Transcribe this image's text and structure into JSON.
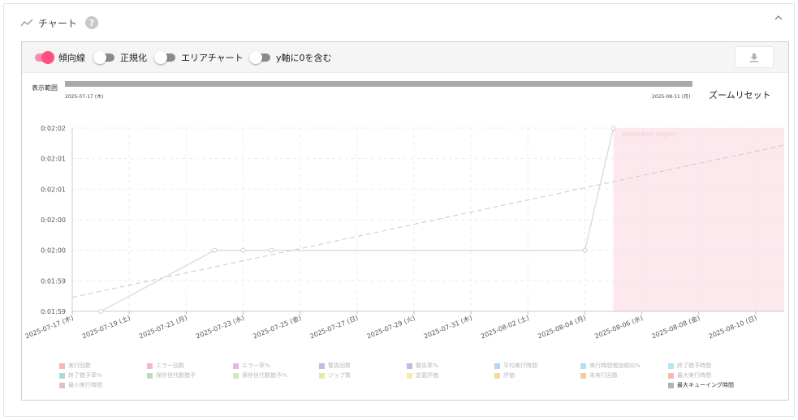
{
  "header": {
    "title": "チャート",
    "help_label": "?"
  },
  "toolbar": {
    "toggles": [
      {
        "label": "傾向線",
        "on": true
      },
      {
        "label": "正規化",
        "on": false
      },
      {
        "label": "エリアチャート",
        "on": false
      },
      {
        "label": "y軸に0を含む",
        "on": false
      }
    ]
  },
  "range": {
    "label": "表示範囲",
    "start": "2025-07-17 (木)",
    "end": "2025-08-11 (月)",
    "zoom_reset": "ズームリセット"
  },
  "colors": {
    "accent": "#ff4f81",
    "prediction_fill": "#fde8ee",
    "line": "#d9d9d9",
    "trend": "#d6c4c8"
  },
  "chart_data": {
    "type": "line",
    "title": "",
    "xlabel": "",
    "ylabel": "",
    "x_ticks": [
      "2025-07-17 (木)",
      "2025-07-19 (土)",
      "2025-07-21 (月)",
      "2025-07-23 (水)",
      "2025-07-25 (金)",
      "2025-07-27 (日)",
      "2025-07-29 (火)",
      "2025-07-31 (木)",
      "2025-08-02 (土)",
      "2025-08-04 (月)",
      "2025-08-06 (水)",
      "2025-08-08 (金)",
      "2025-08-10 (日)"
    ],
    "y_ticks": [
      "0:01:59",
      "0:01:59",
      "0:02:00",
      "0:02:00",
      "0:02:01",
      "0:02:01",
      "0:02:02"
    ],
    "y_tick_values": [
      119.0,
      119.5,
      120.0,
      120.5,
      121.0,
      121.5,
      122.0
    ],
    "ylim": [
      119.0,
      122.0
    ],
    "xlim": [
      "2025-07-17",
      "2025-08-11"
    ],
    "grid": true,
    "series": [
      {
        "name": "最大キューイング時間",
        "x": [
          "2025-07-18",
          "2025-07-22",
          "2025-07-23",
          "2025-07-24",
          "2025-08-04",
          "2025-08-05"
        ],
        "values": [
          119.0,
          120.0,
          120.0,
          120.0,
          120.0,
          122.0
        ]
      }
    ],
    "trend_line": {
      "x": [
        "2025-07-17",
        "2025-08-11"
      ],
      "values": [
        119.23,
        121.72
      ]
    },
    "prediction_region": {
      "label": "prediction region",
      "x_start": "2025-08-05",
      "x_end": "2025-08-11"
    },
    "legend": [
      {
        "label": "実行回数",
        "color": "#f4b8b8",
        "active": false
      },
      {
        "label": "エラー回数",
        "color": "#f7b6c8",
        "active": false
      },
      {
        "label": "エラー率%",
        "color": "#e7b8e5",
        "active": false
      },
      {
        "label": "警告回数",
        "color": "#c9b8e4",
        "active": false
      },
      {
        "label": "警告率%",
        "color": "#bcbce9",
        "active": false
      },
      {
        "label": "平均実行時間",
        "color": "#b6d6f4",
        "active": false
      },
      {
        "label": "実行時間増加傾向%",
        "color": "#b4e0f2",
        "active": false
      },
      {
        "label": "終了猶予時間",
        "color": "#b5e8ee",
        "active": false
      },
      {
        "label": "終了猶予率%",
        "color": "#a9dad6",
        "active": false
      },
      {
        "label": "保存世代数猶予",
        "color": "#b4e0bc",
        "active": false
      },
      {
        "label": "保存世代数猶予%",
        "color": "#d0eab8",
        "active": false
      },
      {
        "label": "ジョブ数",
        "color": "#e4eca8",
        "active": false
      },
      {
        "label": "定義評価",
        "color": "#f7ebb0",
        "active": false
      },
      {
        "label": "評価",
        "color": "#f8d8a0",
        "active": false
      },
      {
        "label": "未実行回数",
        "color": "#f6c8a4",
        "active": false
      },
      {
        "label": "最大実行時間",
        "color": "#f4bcb0",
        "active": false
      },
      {
        "label": "最小実行時間",
        "color": "#e2c0c0",
        "active": false
      },
      {
        "label": "最大キューイング時間",
        "color": "#b3b3b3",
        "active": true
      }
    ]
  }
}
